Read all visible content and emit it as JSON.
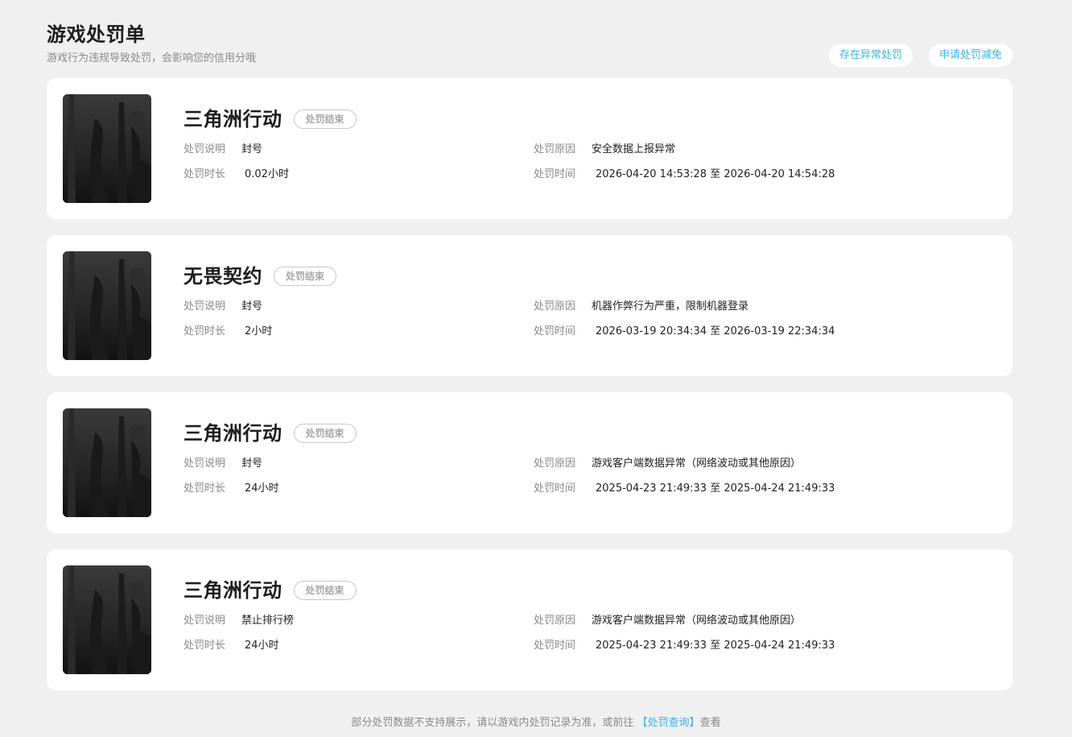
{
  "header": {
    "title": "游戏处罚单",
    "subtitle": "游戏行为违规导致处罚，会影响您的信用分哦",
    "actions": [
      {
        "label": "存在异常处罚"
      },
      {
        "label": "申请处罚减免"
      }
    ]
  },
  "labels": {
    "description": "处罚说明",
    "duration": "处罚时长",
    "reason": "处罚原因",
    "time": "处罚时间"
  },
  "records": [
    {
      "game": "三角洲行动",
      "status": "处罚结束",
      "description": "封号",
      "duration": "0.02小时",
      "reason": "安全数据上报异常",
      "time": "2026-04-20 14:53:28 至 2026-04-20 14:54:28"
    },
    {
      "game": "无畏契约",
      "status": "处罚结束",
      "description": "封号",
      "duration": "2小时",
      "reason": "机器作弊行为严重，限制机器登录",
      "time": "2026-03-19 20:34:34 至 2026-03-19 22:34:34"
    },
    {
      "game": "三角洲行动",
      "status": "处罚结束",
      "description": "封号",
      "duration": "24小时",
      "reason": "游戏客户端数据异常（网络波动或其他原因）",
      "time": "2025-04-23 21:49:33 至 2025-04-24 21:49:33"
    },
    {
      "game": "三角洲行动",
      "status": "处罚结束",
      "description": "禁止排行榜",
      "duration": "24小时",
      "reason": "游戏客户端数据异常（网络波动或其他原因）",
      "time": "2025-04-23 21:49:33 至 2025-04-24 21:49:33"
    }
  ],
  "footer": {
    "prefix": "部分处罚数据不支持展示，请以游戏内处罚记录为准，或前往 ",
    "link": "【处罚查询】",
    "suffix": "查看"
  },
  "colors": {
    "background": "#f0f0f0",
    "card": "#ffffff",
    "accent": "#3cb4e6",
    "muted": "#8a8a8a",
    "badge_border": "#c8c8c8"
  },
  "icons": {
    "cover": "game-cover-image"
  }
}
